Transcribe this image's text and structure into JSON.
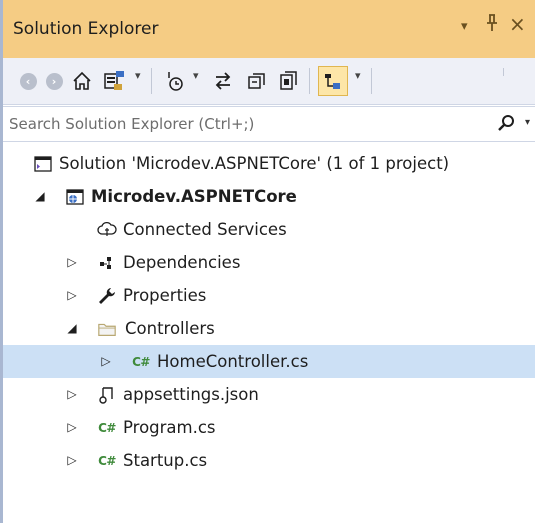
{
  "window": {
    "title": "Solution Explorer",
    "dropdown_glyph": "▾",
    "pin_glyph": "⊥",
    "close_glyph": "×"
  },
  "toolbar": {
    "icons": [
      "back-icon",
      "forward-icon",
      "home-icon",
      "switch-views-icon",
      "pending-changes-filter-icon",
      "sync-with-document-icon",
      "collapse-all-icon",
      "show-all-files-icon",
      "preview-selected-items-icon"
    ],
    "back_glyph": "‹",
    "forward_glyph": "›",
    "dropdown_glyph": "▾"
  },
  "search": {
    "placeholder": "Search Solution Explorer (Ctrl+;)",
    "dropdown_glyph": "▾"
  },
  "tree": {
    "items": [
      {
        "label": "Solution 'Microdev.ASPNETCore' (1 of 1 project)",
        "icon": "solution-icon",
        "expanded": null
      },
      {
        "label": "Microdev.ASPNETCore",
        "icon": "web-project-icon",
        "expanded": true,
        "bold": true
      },
      {
        "label": "Connected Services",
        "icon": "connected-services-icon",
        "expanded": null
      },
      {
        "label": "Dependencies",
        "icon": "dependencies-icon",
        "expanded": false
      },
      {
        "label": "Properties",
        "icon": "wrench-icon",
        "expanded": false
      },
      {
        "label": "Controllers",
        "icon": "folder-icon",
        "expanded": true
      },
      {
        "label": "HomeController.cs",
        "icon": "csharp-file-icon",
        "expanded": false,
        "selected": true
      },
      {
        "label": "appsettings.json",
        "icon": "json-file-icon",
        "expanded": false
      },
      {
        "label": "Program.cs",
        "icon": "csharp-file-icon",
        "expanded": false
      },
      {
        "label": "Startup.cs",
        "icon": "csharp-file-icon",
        "expanded": false
      }
    ],
    "csharp_badge": "C#",
    "expanded_glyph": "◢",
    "collapsed_glyph": "▷"
  },
  "colors": {
    "title_bar": "#f5cc84",
    "toolbar": "#eef0f7",
    "selection": "#cce0f5",
    "csharp_green": "#3f8a3b"
  }
}
